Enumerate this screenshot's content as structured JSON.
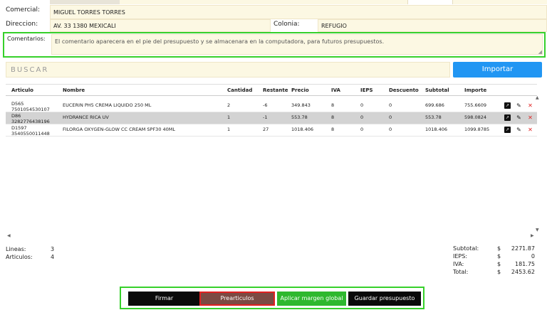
{
  "form": {
    "comercial_label": "Comercial:",
    "comercial_value": "MIGUEL TORRES TORRES",
    "direccion_label": "Direccion:",
    "direccion_value": "AV. 33 1380 MEXICALI",
    "colonia_label": "Colonia:",
    "colonia_value": "REFUGIO",
    "comentarios_label": "Comentarios:",
    "comentarios_placeholder": "El comentario aparecera en el pie del presupuesto y se almacenara en la computadora, para futuros presupuestos."
  },
  "search": {
    "placeholder": "BUSCAR",
    "import_label": "Importar"
  },
  "table": {
    "headers": {
      "articulo": "Articulo",
      "nombre": "Nombre",
      "cantidad": "Cantidad",
      "restante": "Restante",
      "precio": "Precio",
      "iva": "IVA",
      "ieps": "IEPS",
      "descuento": "Descuento",
      "subtotal": "Subtotal",
      "importe": "Importe"
    },
    "rows": [
      {
        "code": "D565",
        "barcode": "7501054530107",
        "nombre": "EUCERIN PH5 CREMA LIQUIDO 250 ML",
        "cantidad": "2",
        "restante": "-6",
        "precio": "349.843",
        "iva": "8",
        "ieps": "0",
        "descuento": "0",
        "subtotal": "699.686",
        "importe": "755.6609"
      },
      {
        "code": "D86",
        "barcode": "3282776438196",
        "nombre": "HYDRANCE RICA UV",
        "cantidad": "1",
        "restante": "-1",
        "precio": "553.78",
        "iva": "8",
        "ieps": "0",
        "descuento": "0",
        "subtotal": "553.78",
        "importe": "598.0824"
      },
      {
        "code": "D1597",
        "barcode": "3540550011448",
        "nombre": "FILORGA OXYGEN-GLOW CC CREAM SPF30 40ML",
        "cantidad": "1",
        "restante": "27",
        "precio": "1018.406",
        "iva": "8",
        "ieps": "0",
        "descuento": "0",
        "subtotal": "1018.406",
        "importe": "1099.8785"
      }
    ]
  },
  "summary": {
    "lineas_label": "Lineas:",
    "lineas_value": "3",
    "articulos_label": "Articulos:",
    "articulos_value": "4"
  },
  "totals": {
    "currency": "$",
    "subtotal_label": "Subtotal:",
    "subtotal_value": "2271.87",
    "ieps_label": "IEPS:",
    "ieps_value": "0",
    "iva_label": "IVA:",
    "iva_value": "181.75",
    "total_label": "Total:",
    "total_value": "2453.62"
  },
  "actions": {
    "firmar": "Firmar",
    "prearticulos": "Prearticulos",
    "aplicar_margen": "Aplicar margen global",
    "guardar": "Guardar presupuesto"
  },
  "icons": {
    "external": "external-link-icon",
    "edit": "pencil-icon",
    "delete": "close-icon"
  },
  "colors": {
    "field_bg": "#fcf8e3",
    "import_btn": "#2196f3",
    "highlight_border": "#36d02a",
    "prearticulos_btn": "#7b4a43",
    "margen_btn": "#2eb82e",
    "delete_red": "#e02020"
  }
}
